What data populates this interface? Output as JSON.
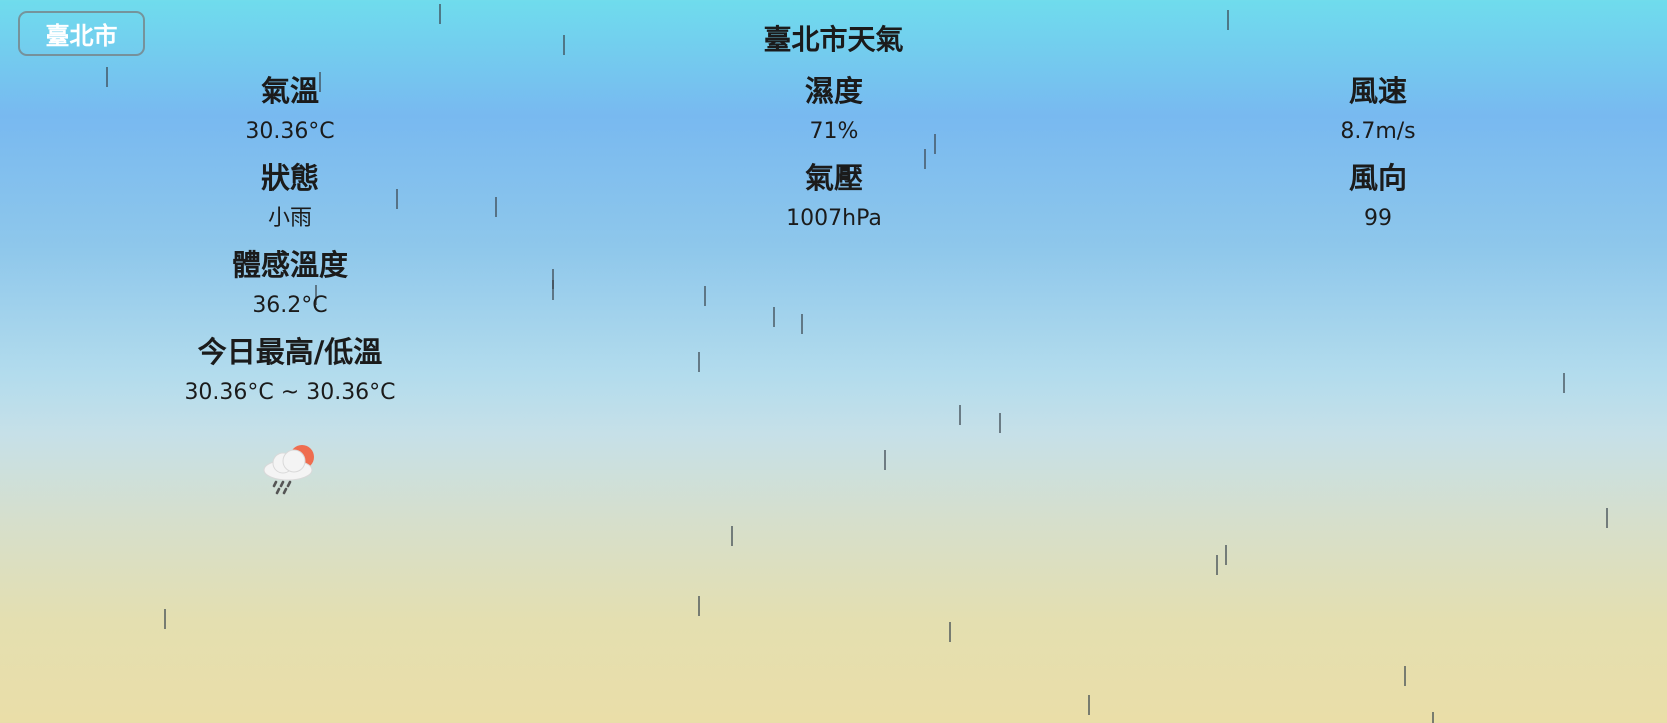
{
  "city_button": {
    "label": "臺北市"
  },
  "page": {
    "title": "臺北市天氣"
  },
  "weather": {
    "temperature": {
      "label": "氣溫",
      "value": "30.36°C"
    },
    "status": {
      "label": "狀態",
      "value": "小雨"
    },
    "feels_like": {
      "label": "體感溫度",
      "value": "36.2°C"
    },
    "high_low": {
      "label": "今日最高/低溫",
      "value": "30.36°C ~ 30.36°C"
    },
    "humidity": {
      "label": "濕度",
      "value": "71%"
    },
    "pressure": {
      "label": "氣壓",
      "value": "1007hPa"
    },
    "wind_speed": {
      "label": "風速",
      "value": "8.7m/s"
    },
    "wind_direction": {
      "label": "風向",
      "value": "99"
    },
    "icon": "sun-cloud-rain-icon"
  }
}
